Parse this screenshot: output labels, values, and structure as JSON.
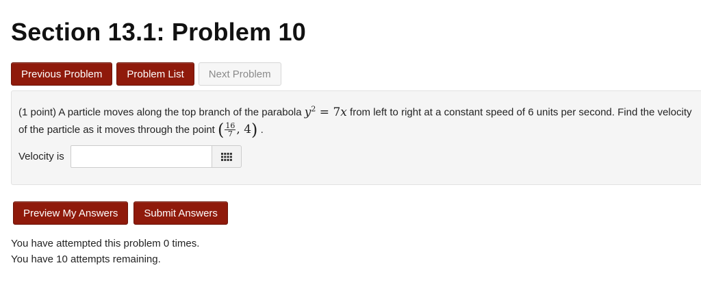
{
  "header": {
    "title": "Section 13.1: Problem 10"
  },
  "nav": {
    "previous_label": "Previous Problem",
    "list_label": "Problem List",
    "next_label": "Next Problem"
  },
  "problem": {
    "points": "(1 point)",
    "text_part1": "A particle moves along the top branch of the parabola",
    "eq_lhs": "y",
    "eq_exp": "2",
    "eq_eq": "=",
    "eq_rhs_coef": "7",
    "eq_rhs_var": "x",
    "text_part2": "from left to right at a constant speed of 6 units per second. Find the velocity of the particle as it moves through the point",
    "point_num": "16",
    "point_den": "7",
    "point_y": "4",
    "text_end": "."
  },
  "answer": {
    "label": "Velocity is",
    "value": "",
    "placeholder": "",
    "keypad_icon": "grid-keypad-icon"
  },
  "actions": {
    "preview_label": "Preview My Answers",
    "submit_label": "Submit Answers"
  },
  "status": {
    "attempted": "You have attempted this problem 0 times.",
    "remaining": "You have 10 attempts remaining."
  },
  "colors": {
    "primary_button": "#8f1a0b",
    "disabled_button": "#f6f6f6",
    "problem_background": "#f5f5f5"
  }
}
